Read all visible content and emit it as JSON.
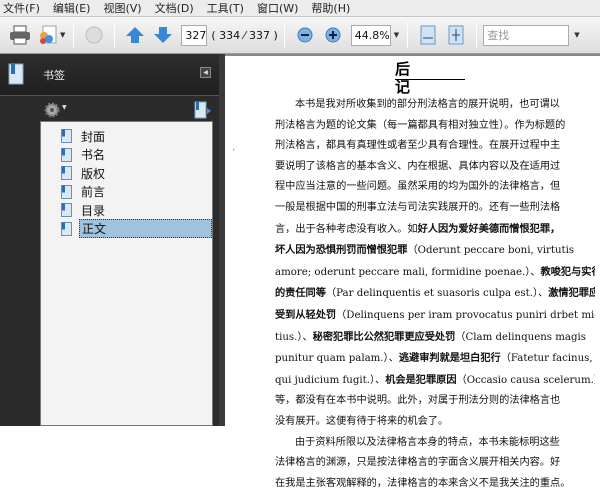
{
  "menu": [
    "文件(F)",
    "编辑(E)",
    "视图(V)",
    "文档(D)",
    "工具(T)",
    "窗口(W)",
    "帮助(H)"
  ],
  "toolbar": {
    "page_input": "327",
    "page_count": "( 334 ⁄ 337 )",
    "zoom": "44.8%",
    "search_placeholder": "查找"
  },
  "sidebar": {
    "title": "书签",
    "bookmarks": [
      {
        "label": "封面"
      },
      {
        "label": "书名"
      },
      {
        "label": "版权"
      },
      {
        "label": "前言"
      },
      {
        "label": "目录"
      },
      {
        "label": "正文",
        "selected": true
      }
    ]
  },
  "colors": {
    "sidebar_bg": "#2b2b2b",
    "selection": "#9fc3df",
    "toolbar_blue": "#3a87d4"
  },
  "document": {
    "title": "后记",
    "mark": "'",
    "lines": [
      {
        "indent": true,
        "segs": [
          {
            "t": "本书是我对所收集到的部分刑法格言的展开说明，也可谓以"
          }
        ]
      },
      {
        "segs": [
          {
            "t": "刑法格言为题的论文集（每一篇都具有相对独立性）。作为标题的"
          }
        ]
      },
      {
        "segs": [
          {
            "t": "刑法格言，都具有真理性或者至少具有合理性。在展开过程中主"
          }
        ]
      },
      {
        "segs": [
          {
            "t": "要说明了该格言的基本含义、内在根据、具体内容以及在适用过"
          }
        ]
      },
      {
        "segs": [
          {
            "t": "程中应当注意的一些问题。虽然采用的均为国外的法律格言，但"
          }
        ]
      },
      {
        "segs": [
          {
            "t": "一般是根据中国的刑事立法与司法实践展开的。还有一些刑法格"
          }
        ]
      },
      {
        "segs": [
          {
            "t": "言，出于各种考虑没有收入。如"
          },
          {
            "t": "好人因为爱好美德而憎恨犯罪，",
            "b": true
          }
        ]
      },
      {
        "segs": [
          {
            "t": "坏人因为恐惧刑罚而憎恨犯罪",
            "b": true
          },
          {
            "t": "（Oderunt peccare boni, virtutis"
          }
        ]
      },
      {
        "segs": [
          {
            "t": "amore; oderunt peccare mali, formidine poenae.）、"
          },
          {
            "t": "教唆犯与实行犯",
            "b": true
          }
        ]
      },
      {
        "segs": [
          {
            "t": "的责任同等",
            "b": true
          },
          {
            "t": "（Par delinquentis et suasoris culpa est.）、"
          },
          {
            "t": "激情犯罪应当",
            "b": true
          }
        ]
      },
      {
        "segs": [
          {
            "t": "受到从轻处罚",
            "b": true
          },
          {
            "t": "（Delinquens per iram provocatus puniri drbet mi-"
          }
        ]
      },
      {
        "segs": [
          {
            "t": "tius.）、"
          },
          {
            "t": "秘密犯罪比公然犯罪更应受处罚",
            "b": true
          },
          {
            "t": "（Clam delinquens magis"
          }
        ]
      },
      {
        "segs": [
          {
            "t": "punitur quam palam.）、"
          },
          {
            "t": "逃避审判就是坦白犯行",
            "b": true
          },
          {
            "t": "（Fatetur facinus,"
          }
        ]
      },
      {
        "segs": [
          {
            "t": "qui judicium fugit.）、"
          },
          {
            "t": "机会是犯罪原因",
            "b": true
          },
          {
            "t": "（Occasio causa scelerum.）等"
          }
        ]
      },
      {
        "segs": [
          {
            "t": "等，都没有在本书中说明。此外，对属于刑法分则的法律格言也"
          }
        ]
      },
      {
        "segs": [
          {
            "t": "没有展开。这便有待于将来的机会了。"
          }
        ]
      },
      {
        "indent": true,
        "segs": [
          {
            "t": "由于资料所限以及法律格言本身的特点，本书未能标明这些"
          }
        ]
      },
      {
        "segs": [
          {
            "t": "法律格言的渊源，只是按法律格言的字面含义展开相关内容。好"
          }
        ]
      },
      {
        "segs": [
          {
            "t": "在我是主张客观解释的，法律格言的本来含义不是我关注的重点。"
          }
        ]
      }
    ]
  }
}
